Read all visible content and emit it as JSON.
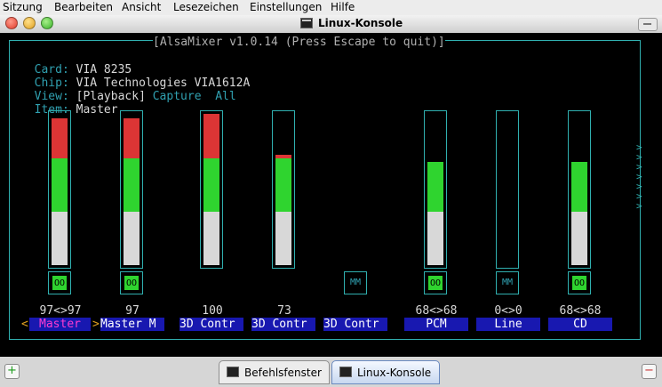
{
  "menu": [
    "Sitzung",
    "Bearbeiten",
    "Ansicht",
    "Lesezeichen",
    "Einstellungen",
    "Hilfe"
  ],
  "window": {
    "title": "Linux-Konsole"
  },
  "mixer": {
    "header": "[AlsaMixer v1.0.14 (Press Escape to quit)]",
    "card_label": "Card:",
    "card_value": "VIA 8235",
    "chip_label": "Chip:",
    "chip_value": "VIA Technologies VIA1612A",
    "view_label": "View:",
    "view_selected": "[Playback]",
    "view_opt1": "Capture",
    "view_opt2": "All",
    "item_label": "Item:",
    "item_value": "Master",
    "channels": [
      {
        "label": "Master",
        "value": "97<>97",
        "switch": "OO",
        "level": 0.97
      },
      {
        "label": "Master M",
        "value": "97",
        "switch": "OO",
        "level": 0.97
      },
      {
        "label": "3D Contr",
        "value": "100",
        "switch": "",
        "level": 1.0
      },
      {
        "label": "3D Contr",
        "value": "73",
        "switch": "",
        "level": 0.73
      },
      {
        "label": "3D Contr",
        "value": "",
        "switch": "MM",
        "level": null
      },
      {
        "label": "PCM",
        "value": "68<>68",
        "switch": "OO",
        "level": 0.68
      },
      {
        "label": "Line",
        "value": "0<>0",
        "switch": "MM",
        "level": 0
      },
      {
        "label": "CD",
        "value": "68<>68",
        "switch": "OO",
        "level": 0.68
      }
    ]
  },
  "tabs": [
    {
      "label": "Befehlsfenster"
    },
    {
      "label": "Linux-Konsole"
    }
  ],
  "colors": {
    "accent": "#30b0b0",
    "label_bg": "#1818b0",
    "active_label": "#ff3bd0"
  }
}
